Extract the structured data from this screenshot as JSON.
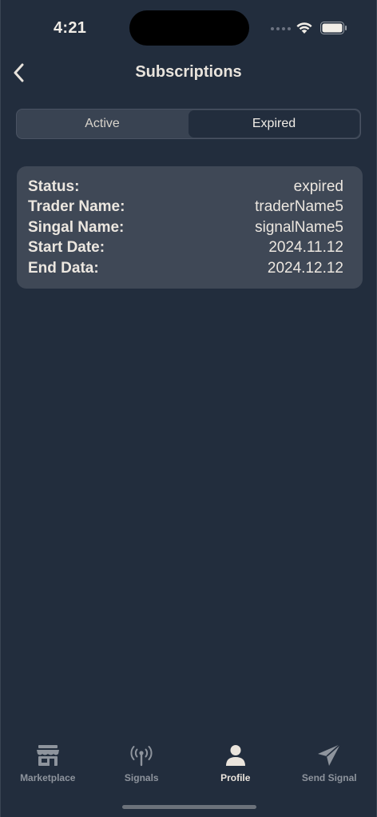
{
  "status_bar": {
    "time": "4:21"
  },
  "nav": {
    "title": "Subscriptions"
  },
  "segmented": {
    "active_label": "Active",
    "expired_label": "Expired",
    "selected": "Expired"
  },
  "subscription": {
    "fields": [
      {
        "label": "Status:",
        "value": "expired"
      },
      {
        "label": "Trader Name:",
        "value": "traderName5"
      },
      {
        "label": "Singal Name:",
        "value": "signalName5"
      },
      {
        "label": "Start Date:",
        "value": "2024.11.12"
      },
      {
        "label": "End Data:",
        "value": "2024.12.12"
      }
    ]
  },
  "tab_bar": {
    "items": [
      {
        "label": "Marketplace",
        "icon": "store-icon",
        "active": false
      },
      {
        "label": "Signals",
        "icon": "antenna-icon",
        "active": false
      },
      {
        "label": "Profile",
        "icon": "person-icon",
        "active": true
      },
      {
        "label": "Send Signal",
        "icon": "paper-plane-icon",
        "active": false
      }
    ]
  },
  "colors": {
    "background": "#222d3d",
    "card": "#3f4856",
    "text": "#ece7e0",
    "inactive_tab": "#8e949d"
  }
}
